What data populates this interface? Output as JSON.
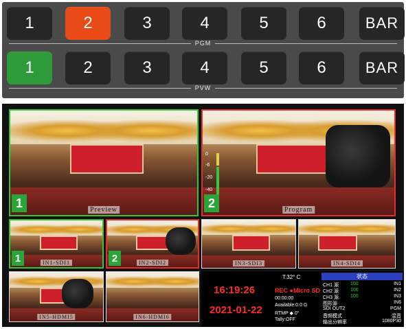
{
  "pgm_row": {
    "label": "PGM",
    "buttons": [
      "1",
      "2",
      "3",
      "4",
      "5",
      "6",
      "BAR"
    ],
    "active_index": 1,
    "active_color": "#ea4a15"
  },
  "pvw_row": {
    "label": "PVW",
    "buttons": [
      "1",
      "2",
      "3",
      "4",
      "5",
      "6",
      "BAR"
    ],
    "active_index": 0,
    "active_color": "#2f9a3a"
  },
  "multiview": {
    "preview": {
      "label": "Preview",
      "number": "1"
    },
    "program": {
      "label": "Program",
      "number": "2"
    },
    "vu_ticks": [
      "0",
      "-6",
      "-20",
      "-40"
    ],
    "sources": [
      {
        "label": "IN1-SDI1",
        "number": "1"
      },
      {
        "label": "IN2-SDI2",
        "number": "2"
      },
      {
        "label": "IN3-SDI3"
      },
      {
        "label": "IN4-SDI4"
      },
      {
        "label": "IN5-HDMI5"
      },
      {
        "label": "IN6-HDMI6"
      }
    ]
  },
  "info": {
    "time": "16:19:26",
    "date": "2021-01-22",
    "temperature": "T:32° C",
    "rec": "REC ●Micro SD",
    "rec_time": "00:00:00",
    "available": "Available:0.0   G",
    "rtmp": "RTMP  ◆    0\"",
    "tally": "Tally:OFF"
  },
  "status": {
    "title": "状态",
    "rows": [
      {
        "a": "CH1 源",
        "b": "100",
        "c": "IN1"
      },
      {
        "a": "CH2 源",
        "b": "100",
        "c": "IN2"
      },
      {
        "a": "CH3 源",
        "b": "100",
        "c": "IN3"
      },
      {
        "a": "图形源",
        "b": "",
        "c": "IN6"
      },
      {
        "a": "SDI OUT2",
        "b": "",
        "c": "PGM"
      },
      {
        "a": "音频模式",
        "b": "",
        "c": "混音"
      },
      {
        "a": "输出分辨率",
        "b": "",
        "c": "1080P30"
      }
    ]
  }
}
